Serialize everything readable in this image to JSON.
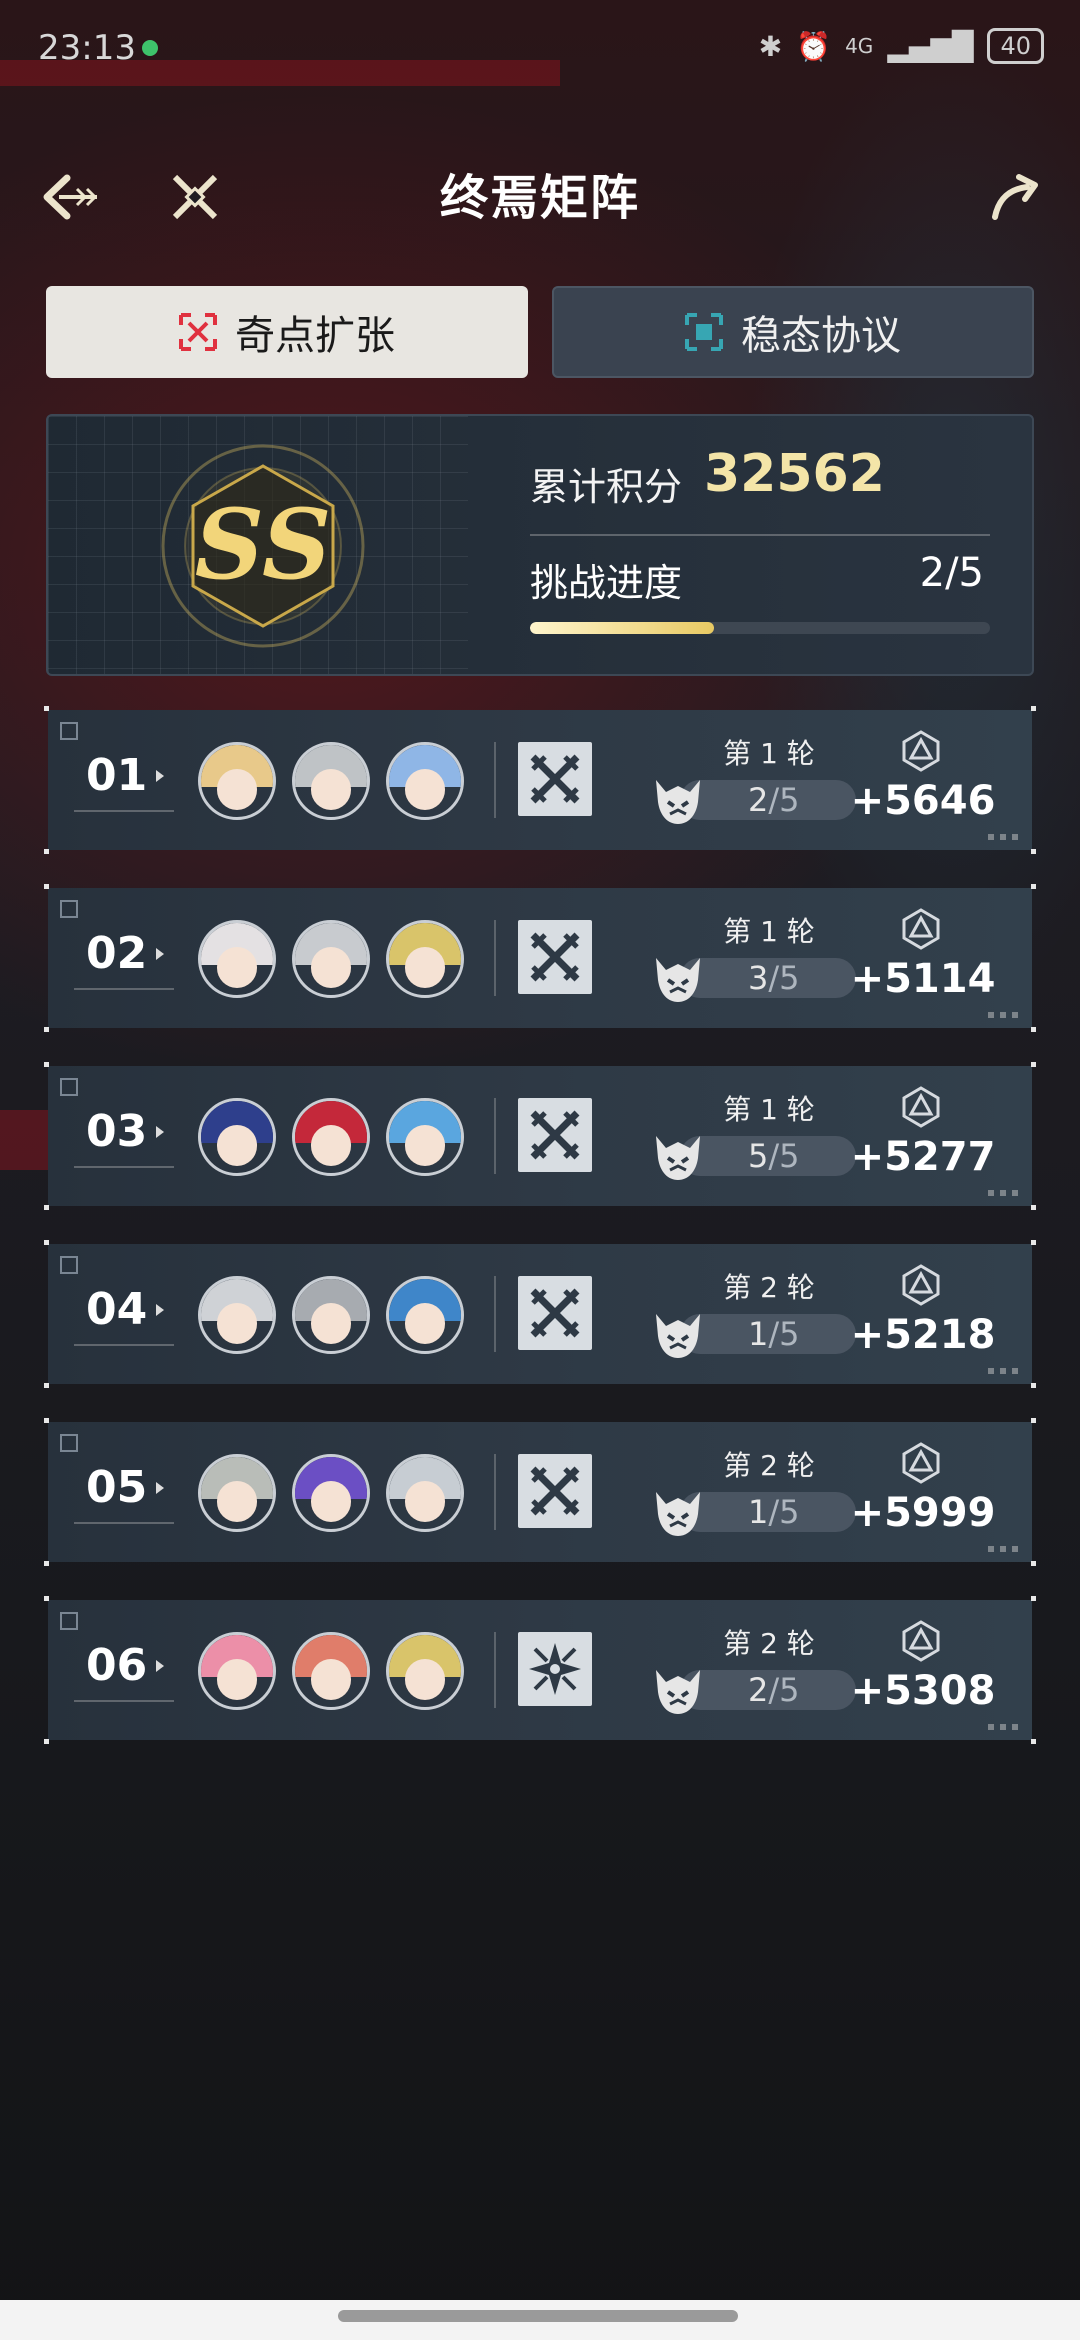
{
  "status_bar": {
    "time": "23:13",
    "network": "4G",
    "battery": "40"
  },
  "header": {
    "title": "终焉矩阵"
  },
  "tabs": [
    {
      "label": "奇点扩张",
      "active": true,
      "icon": "singularity-icon"
    },
    {
      "label": "稳态协议",
      "active": false,
      "icon": "steady-state-icon"
    }
  ],
  "summary": {
    "rank": "SS",
    "score_label": "累计积分",
    "score_value": "32562",
    "progress_label": "挑战进度",
    "progress_value": "2/5",
    "progress_fraction": 0.4
  },
  "rows": [
    {
      "number": "01",
      "round": "第 1 轮",
      "attempt": "2",
      "attempt_total": "/5",
      "reward": "+5646",
      "mode_icon": "crossed-swords-icon",
      "avatars": [
        {
          "hair": "#e8c98a"
        },
        {
          "hair": "#bfc3c6"
        },
        {
          "hair": "#8fb6e6"
        }
      ]
    },
    {
      "number": "02",
      "round": "第 1 轮",
      "attempt": "3",
      "attempt_total": "/5",
      "reward": "+5114",
      "mode_icon": "crossed-swords-icon",
      "avatars": [
        {
          "hair": "#e4e1e3"
        },
        {
          "hair": "#c8cbcf"
        },
        {
          "hair": "#d9c46a"
        }
      ]
    },
    {
      "number": "03",
      "round": "第 1 轮",
      "attempt": "5",
      "attempt_total": "/5",
      "reward": "+5277",
      "mode_icon": "crossed-swords-icon",
      "avatars": [
        {
          "hair": "#2e3f8c"
        },
        {
          "hair": "#c4283a"
        },
        {
          "hair": "#5aa6df"
        }
      ]
    },
    {
      "number": "04",
      "round": "第 2 轮",
      "attempt": "1",
      "attempt_total": "/5",
      "reward": "+5218",
      "mode_icon": "crossed-swords-icon",
      "avatars": [
        {
          "hair": "#cfd2d6"
        },
        {
          "hair": "#a7abb0"
        },
        {
          "hair": "#3f86c9"
        }
      ]
    },
    {
      "number": "05",
      "round": "第 2 轮",
      "attempt": "1",
      "attempt_total": "/5",
      "reward": "+5999",
      "mode_icon": "crossed-swords-icon",
      "avatars": [
        {
          "hair": "#b9bdb8"
        },
        {
          "hair": "#6b4fc4"
        },
        {
          "hair": "#c7cdd3"
        }
      ]
    },
    {
      "number": "06",
      "round": "第 2 轮",
      "attempt": "2",
      "attempt_total": "/5",
      "reward": "+5308",
      "mode_icon": "shuriken-icon",
      "avatars": [
        {
          "hair": "#ec8fa8"
        },
        {
          "hair": "#e07d6a"
        },
        {
          "hair": "#d9c46a"
        }
      ]
    }
  ]
}
